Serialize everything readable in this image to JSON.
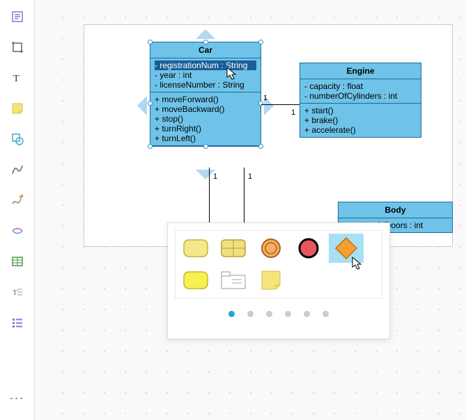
{
  "sidebar": {
    "items": [
      {
        "name": "text-block-icon"
      },
      {
        "name": "crop-icon"
      },
      {
        "name": "text-icon"
      },
      {
        "name": "note-icon"
      },
      {
        "name": "shape-icon"
      },
      {
        "name": "curve-icon"
      },
      {
        "name": "freehand-icon"
      },
      {
        "name": "path-icon"
      },
      {
        "name": "table-icon"
      },
      {
        "name": "text-style-icon"
      },
      {
        "name": "list-icon"
      }
    ],
    "more": "..."
  },
  "classes": {
    "car": {
      "title": "Car",
      "attrs": [
        "- registrationNum : String",
        "- year : int",
        "- licenseNumber : String"
      ],
      "methods": [
        "+ moveForward()",
        "+ moveBackward()",
        "+ stop()",
        "+ turnRight()",
        "+ turnLeft()"
      ]
    },
    "engine": {
      "title": "Engine",
      "attrs": [
        "- capacity : float",
        "- numberOfCylinders : int"
      ],
      "methods": [
        "+ start()",
        "+ brake()",
        "+ accelerate()"
      ]
    },
    "body": {
      "title": "Body",
      "attrs": [
        "- numberOfDoors : int"
      ]
    }
  },
  "multiplicities": {
    "car_engine_left": "1",
    "car_engine_right": "1",
    "car_down_left": "1",
    "car_down_right": "1"
  },
  "palette": {
    "shapes": [
      {
        "name": "rounded-rect-yellow",
        "selected": false
      },
      {
        "name": "grid-rect",
        "selected": false
      },
      {
        "name": "orange-ring",
        "selected": false
      },
      {
        "name": "red-circle",
        "selected": false
      },
      {
        "name": "orange-diamond",
        "selected": true
      },
      {
        "name": "rounded-rect-bright",
        "selected": false
      },
      {
        "name": "tab-rect",
        "selected": false
      },
      {
        "name": "note-shape",
        "selected": false
      }
    ],
    "page_count": 6,
    "active_page": 0
  }
}
